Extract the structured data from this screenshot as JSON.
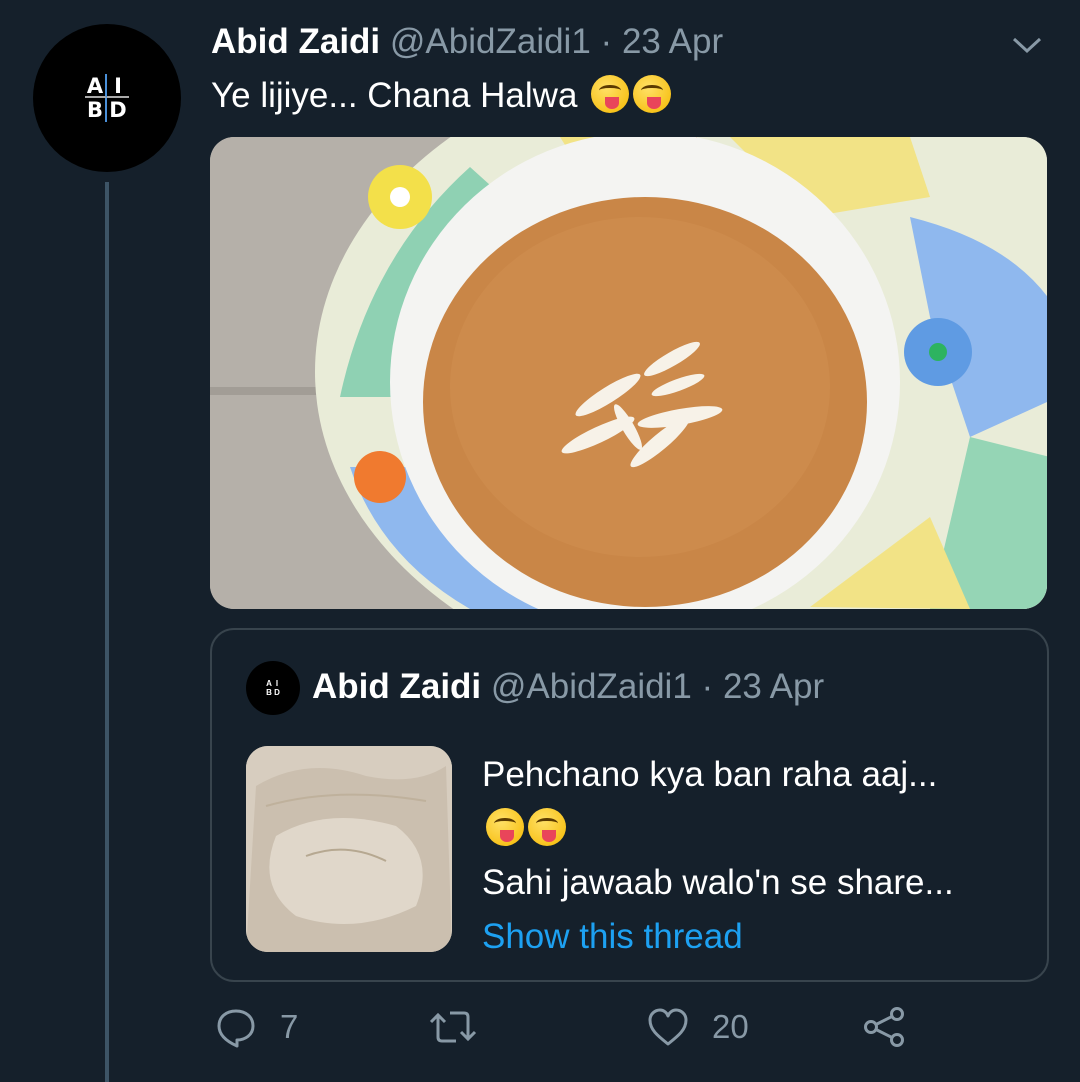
{
  "tweet": {
    "author_name": "Abid Zaidi",
    "author_handle": "@AbidZaidi1",
    "separator": "·",
    "date": "23 Apr",
    "text": "Ye lijiye... Chana Halwa",
    "avatar_letters": [
      "A",
      "I",
      "B",
      "D"
    ]
  },
  "quoted_tweet": {
    "author_name": "Abid Zaidi",
    "author_handle": "@AbidZaidi1",
    "separator": "·",
    "date": "23 Apr",
    "line1": "Pehchano kya ban raha aaj...",
    "line3": "Sahi jawaab walo'n se share...",
    "link": "Show this thread"
  },
  "actions": {
    "reply_count": "7",
    "retweet_count": "",
    "like_count": "20"
  },
  "icons": [
    "chevron-down-icon",
    "reply-icon",
    "retweet-icon",
    "like-icon",
    "share-icon",
    "emoji-yum-icon"
  ],
  "colors": {
    "background": "#15202b",
    "secondary_text": "#8899a6",
    "link": "#1da1f2",
    "border": "#38444d"
  }
}
